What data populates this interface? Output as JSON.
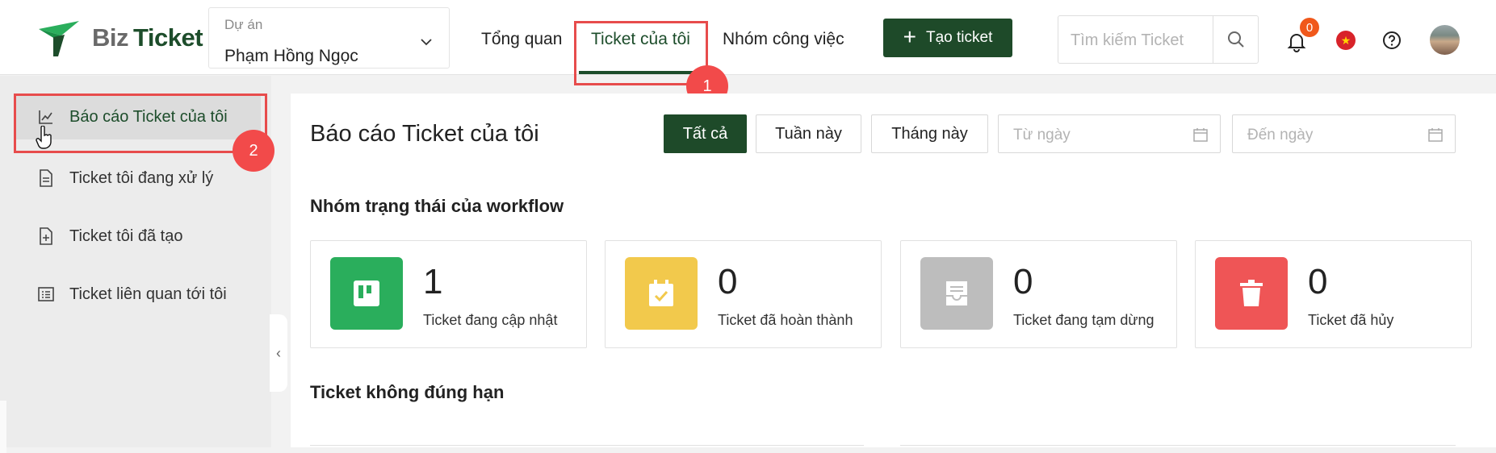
{
  "app": {
    "logo": {
      "text_part1": "Biz",
      "text_part2": "Ticket"
    }
  },
  "header": {
    "project_label": "Dự án",
    "project_value": "Phạm Hồng Ngọc",
    "nav": [
      {
        "label": "Tổng quan",
        "active": false
      },
      {
        "label": "Ticket của tôi",
        "active": true
      },
      {
        "label": "Nhóm công việc",
        "active": false
      }
    ],
    "create_button": "Tạo ticket",
    "search_placeholder": "Tìm kiếm Ticket",
    "notification_count": "0",
    "language_flag": "vietnam-flag-icon",
    "accent_color": "#1e4a29"
  },
  "annotations": {
    "step1": "1",
    "step2": "2",
    "color": "#e74c4c"
  },
  "sidebar": {
    "items": [
      {
        "label": "Báo cáo Ticket của tôi",
        "icon": "line-chart-icon",
        "active": true
      },
      {
        "label": "Ticket tôi đang xử lý",
        "icon": "document-icon",
        "active": false
      },
      {
        "label": "Ticket tôi đã tạo",
        "icon": "document-add-icon",
        "active": false
      },
      {
        "label": "Ticket liên quan tới tôi",
        "icon": "list-icon",
        "active": false
      }
    ]
  },
  "main": {
    "title": "Báo cáo Ticket của tôi",
    "filters": [
      {
        "label": "Tất cả",
        "active": true
      },
      {
        "label": "Tuần này",
        "active": false
      },
      {
        "label": "Tháng này",
        "active": false
      }
    ],
    "date_from_placeholder": "Từ ngày",
    "date_to_placeholder": "Đến ngày",
    "section_status": "Nhóm trạng thái của workflow",
    "cards": [
      {
        "count": "1",
        "label": "Ticket đang cập nhật",
        "color": "#2aae5c",
        "icon": "board-icon"
      },
      {
        "count": "0",
        "label": "Ticket đã hoàn thành",
        "color": "#f2c94c",
        "icon": "calendar-check-icon"
      },
      {
        "count": "0",
        "label": "Ticket đang tạm dừng",
        "color": "#bdbdbd",
        "icon": "archive-icon"
      },
      {
        "count": "0",
        "label": "Ticket đã hủy",
        "color": "#ef5556",
        "icon": "trash-icon"
      }
    ],
    "section_overdue": "Ticket không đúng hạn"
  }
}
